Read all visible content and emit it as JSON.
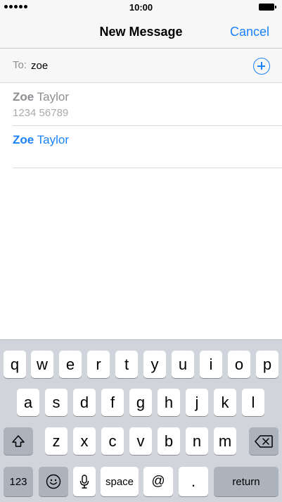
{
  "status_bar": {
    "time": "10:00"
  },
  "nav": {
    "title": "New Message",
    "cancel": "Cancel"
  },
  "recipient": {
    "label": "To:",
    "value": "zoe"
  },
  "suggestions": [
    {
      "match": "Zoe",
      "rest": " Taylor",
      "detail": "1234 56789"
    },
    {
      "match": "Zoe",
      "rest": " Taylor"
    }
  ],
  "keyboard": {
    "row1": [
      "q",
      "w",
      "e",
      "r",
      "t",
      "y",
      "u",
      "i",
      "o",
      "p"
    ],
    "row2": [
      "a",
      "s",
      "d",
      "f",
      "g",
      "h",
      "j",
      "k",
      "l"
    ],
    "row3": [
      "z",
      "x",
      "c",
      "v",
      "b",
      "n",
      "m"
    ],
    "numbers": "123",
    "space": "space",
    "at": "@",
    "period": ".",
    "return": "return"
  },
  "icons": {
    "add_contact": "plus-circle-icon",
    "shift": "shift-arrow-icon",
    "delete": "backspace-icon",
    "emoji": "smiley-icon",
    "dictation": "microphone-icon"
  },
  "colors": {
    "accent": "#1a82fb",
    "keyboard_bg": "#d1d5db",
    "key_dark": "#acb3bd"
  }
}
